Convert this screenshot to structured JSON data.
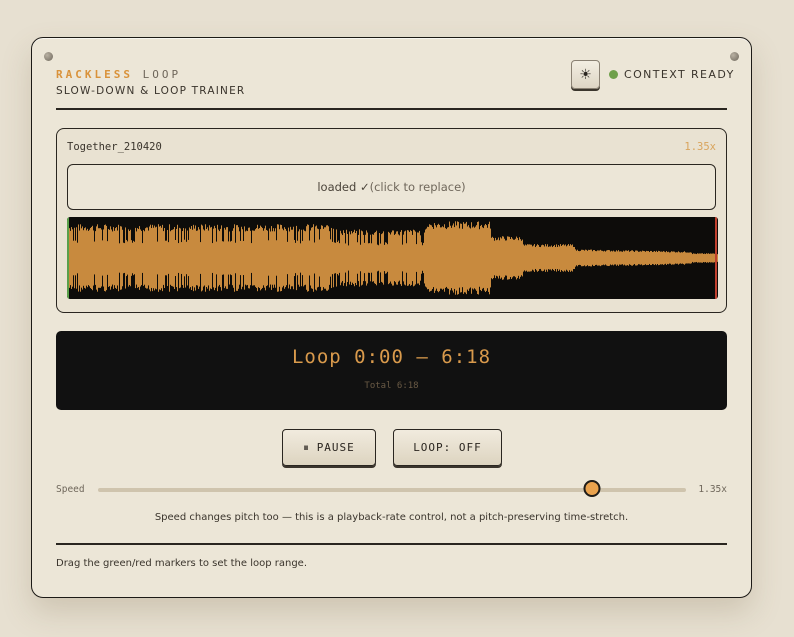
{
  "brand": {
    "name_accent": "RACKLESS",
    "name_rest": "LOOP",
    "subtitle": "SLOW-DOWN & LOOP TRAINER"
  },
  "header": {
    "theme_icon": "sun-icon",
    "status_text": "CONTEXT READY",
    "status_color": "#6fa04a"
  },
  "track": {
    "filename": "Together_210420",
    "rate_label": "1.35x",
    "dropzone_main": "loaded ✓",
    "dropzone_hint": "(click to replace)",
    "waveform_color": "#c88a3e",
    "loop_start_marker_color": "#5aa04a",
    "loop_end_marker_color": "#c0402e"
  },
  "display": {
    "loop_text": "Loop 0:00 – 6:18",
    "total_text": "Total 6:18"
  },
  "controls": {
    "pause_label": "PAUSE",
    "pause_icon": "pause-icon",
    "loop_label": "LOOP: OFF"
  },
  "speed": {
    "label": "Speed",
    "value_label": "1.35x",
    "position": 0.84
  },
  "note": "Speed changes pitch too — this is a playback-rate control, not a pitch-preserving time-stretch.",
  "footer": "Drag the green/red markers to set the loop range.",
  "colors": {
    "accent": "#d9923a",
    "panel": "#ece6d7",
    "background": "#e7e0d1"
  }
}
